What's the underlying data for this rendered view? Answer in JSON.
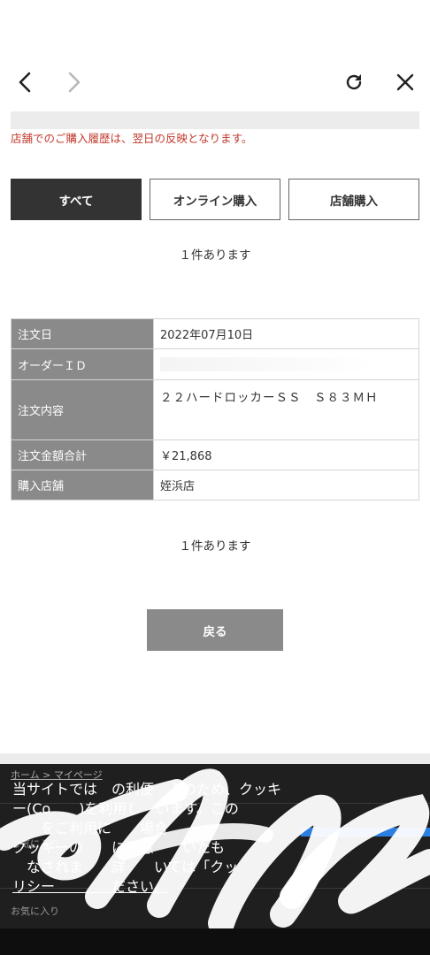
{
  "nav": {
    "back_icon": "chevron-left-icon",
    "forward_icon": "chevron-right-icon",
    "reload_icon": "reload-icon",
    "close_icon": "close-icon"
  },
  "notice": "店舗でのご購入履歴は、翌日の反映となります。",
  "tabs": [
    {
      "label": "すべて",
      "active": true
    },
    {
      "label": "オンライン購入",
      "active": false
    },
    {
      "label": "店舗購入",
      "active": false
    }
  ],
  "count_top": "１件あります",
  "order": {
    "date_label": "注文日",
    "date_value": "2022年07月10日",
    "id_label": "オーダーＩＤ",
    "content_label": "注文内容",
    "content_value": "２２ハードロッカーＳＳ　Ｓ８３ＭＨ",
    "total_label": "注文金額合計",
    "total_value": "￥21,868",
    "store_label": "購入店舗",
    "store_value": "姪浜店"
  },
  "count_bottom": "１件あります",
  "back_button": "戻る",
  "cookie": {
    "breadcrumb": "ホーム > マイページ",
    "line1": "当サイトでは　の利便　上のため、クッキ",
    "line2": "ー(Co　　)を利用し　います。この",
    "line3": "　　をご利用に　　場合",
    "line4": "クッキーの　　に同意　　いたも",
    "line5": "　なされま　　詳　　いては「クッ",
    "line6": "リシー　　　　ださい。",
    "under1": "お気に入り",
    "under2": "お気に入り"
  },
  "colors": {
    "notice": "#c0392b",
    "active_tab": "#333333",
    "table_header": "#8a8a8a",
    "back_button": "#8a8a8a",
    "cookie_bg": "#1f1f1f",
    "accent_blue": "#2c7fe0"
  }
}
